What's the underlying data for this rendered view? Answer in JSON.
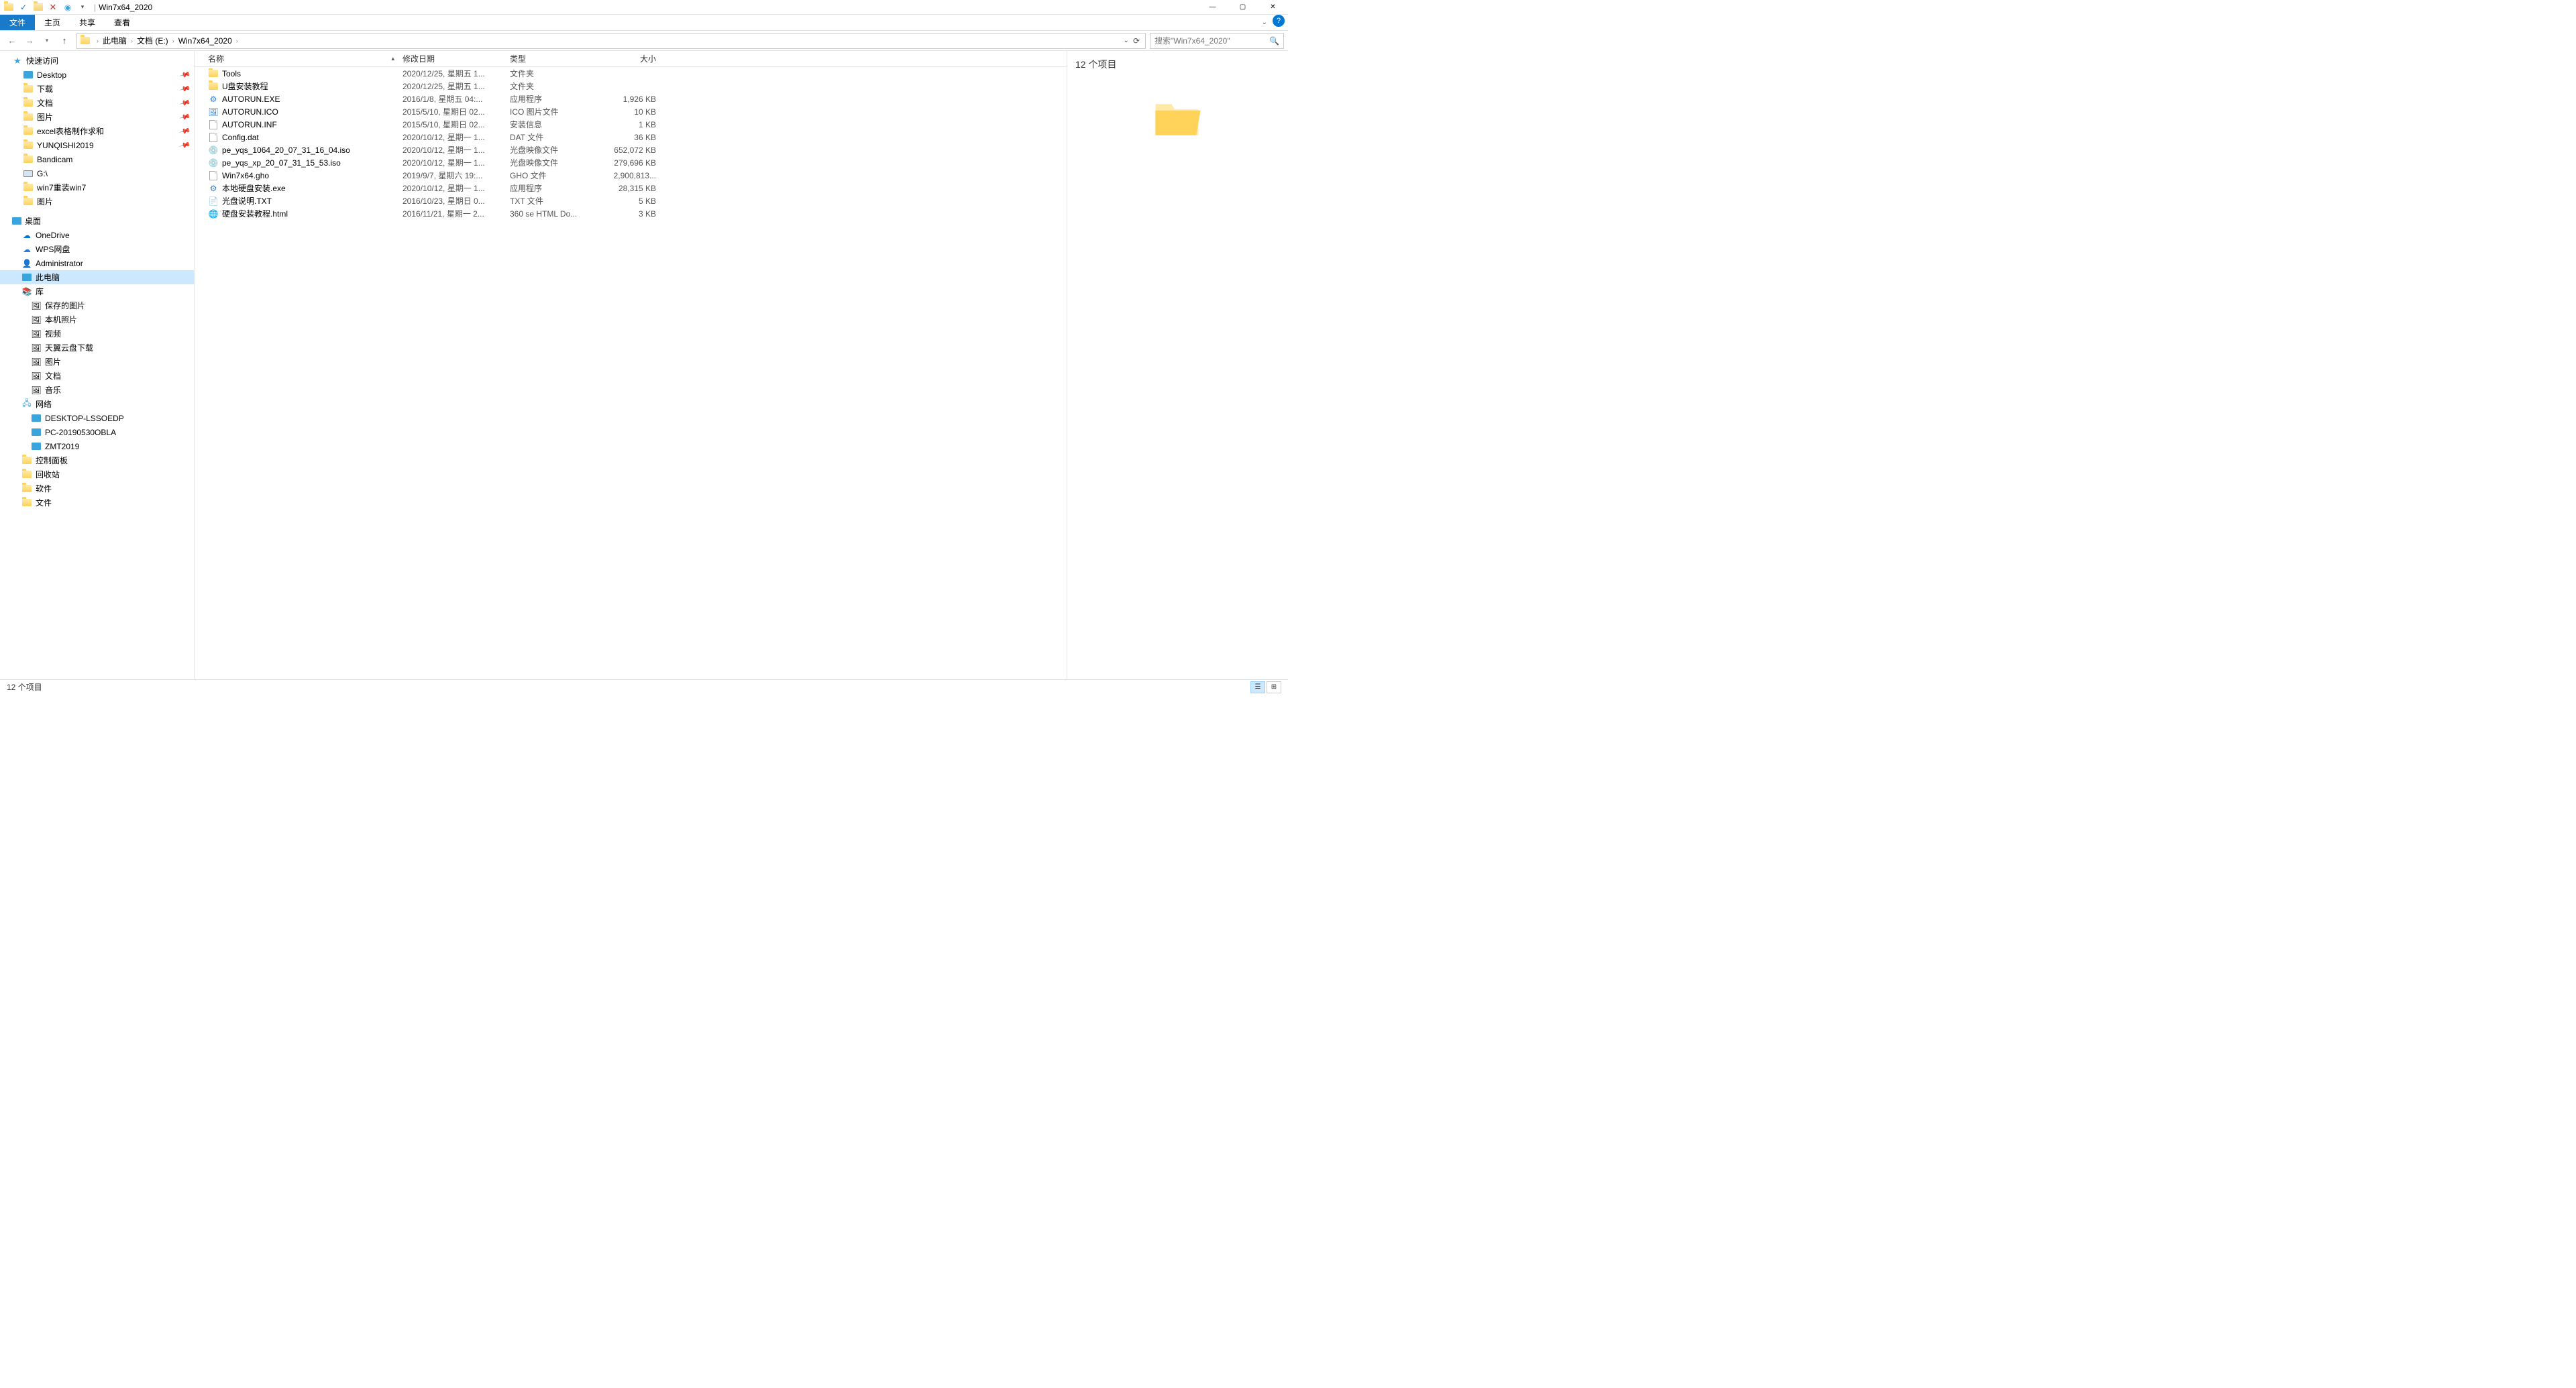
{
  "title": "Win7x64_2020",
  "ribbon": {
    "file": "文件",
    "home": "主页",
    "share": "共享",
    "view": "查看"
  },
  "breadcrumbs": [
    "此电脑",
    "文档 (E:)",
    "Win7x64_2020"
  ],
  "search_placeholder": "搜索\"Win7x64_2020\"",
  "columns": {
    "name": "名称",
    "date": "修改日期",
    "type": "类型",
    "size": "大小"
  },
  "sidebar": {
    "quick_access": "快速访问",
    "quick": [
      {
        "label": "Desktop",
        "icon": "desktop",
        "pin": true
      },
      {
        "label": "下载",
        "icon": "folder",
        "pin": true
      },
      {
        "label": "文档",
        "icon": "folder",
        "pin": true
      },
      {
        "label": "图片",
        "icon": "folder",
        "pin": true
      },
      {
        "label": "excel表格制作求和",
        "icon": "folder",
        "pin": true
      },
      {
        "label": "YUNQISHI2019",
        "icon": "folder",
        "pin": true
      },
      {
        "label": "Bandicam",
        "icon": "folder",
        "pin": false
      },
      {
        "label": "G:\\",
        "icon": "disk",
        "pin": false
      },
      {
        "label": "win7重装win7",
        "icon": "folder",
        "pin": false
      },
      {
        "label": "图片",
        "icon": "folder",
        "pin": false
      }
    ],
    "desktop": "桌面",
    "desktop_items": [
      {
        "label": "OneDrive",
        "icon": "cloud"
      },
      {
        "label": "WPS网盘",
        "icon": "cloud2"
      },
      {
        "label": "Administrator",
        "icon": "user"
      },
      {
        "label": "此电脑",
        "icon": "computer",
        "selected": true
      },
      {
        "label": "库",
        "icon": "lib"
      }
    ],
    "lib_items": [
      {
        "label": "保存的图片"
      },
      {
        "label": "本机照片"
      },
      {
        "label": "视频"
      },
      {
        "label": "天翼云盘下载"
      },
      {
        "label": "图片"
      },
      {
        "label": "文档"
      },
      {
        "label": "音乐"
      }
    ],
    "network": "网络",
    "net_items": [
      {
        "label": "DESKTOP-LSSOEDP"
      },
      {
        "label": "PC-20190530OBLA"
      },
      {
        "label": "ZMT2019"
      }
    ],
    "other": [
      {
        "label": "控制面板"
      },
      {
        "label": "回收站"
      },
      {
        "label": "软件"
      },
      {
        "label": "文件"
      }
    ]
  },
  "files": [
    {
      "name": "Tools",
      "date": "2020/12/25, 星期五 1...",
      "type": "文件夹",
      "size": "",
      "icon": "folder"
    },
    {
      "name": "U盘安装教程",
      "date": "2020/12/25, 星期五 1...",
      "type": "文件夹",
      "size": "",
      "icon": "folder"
    },
    {
      "name": "AUTORUN.EXE",
      "date": "2016/1/8, 星期五 04:...",
      "type": "应用程序",
      "size": "1,926 KB",
      "icon": "exe"
    },
    {
      "name": "AUTORUN.ICO",
      "date": "2015/5/10, 星期日 02...",
      "type": "ICO 图片文件",
      "size": "10 KB",
      "icon": "ico"
    },
    {
      "name": "AUTORUN.INF",
      "date": "2015/5/10, 星期日 02...",
      "type": "安装信息",
      "size": "1 KB",
      "icon": "inf"
    },
    {
      "name": "Config.dat",
      "date": "2020/10/12, 星期一 1...",
      "type": "DAT 文件",
      "size": "36 KB",
      "icon": "dat"
    },
    {
      "name": "pe_yqs_1064_20_07_31_16_04.iso",
      "date": "2020/10/12, 星期一 1...",
      "type": "光盘映像文件",
      "size": "652,072 KB",
      "icon": "iso"
    },
    {
      "name": "pe_yqs_xp_20_07_31_15_53.iso",
      "date": "2020/10/12, 星期一 1...",
      "type": "光盘映像文件",
      "size": "279,696 KB",
      "icon": "iso"
    },
    {
      "name": "Win7x64.gho",
      "date": "2019/9/7, 星期六 19:...",
      "type": "GHO 文件",
      "size": "2,900,813...",
      "icon": "gho"
    },
    {
      "name": "本地硬盘安装.exe",
      "date": "2020/10/12, 星期一 1...",
      "type": "应用程序",
      "size": "28,315 KB",
      "icon": "exe2"
    },
    {
      "name": "光盘说明.TXT",
      "date": "2016/10/23, 星期日 0...",
      "type": "TXT 文件",
      "size": "5 KB",
      "icon": "txt"
    },
    {
      "name": "硬盘安装教程.html",
      "date": "2016/11/21, 星期一 2...",
      "type": "360 se HTML Do...",
      "size": "3 KB",
      "icon": "html"
    }
  ],
  "preview": {
    "title": "12 个项目"
  },
  "statusbar": {
    "text": "12 个项目"
  }
}
